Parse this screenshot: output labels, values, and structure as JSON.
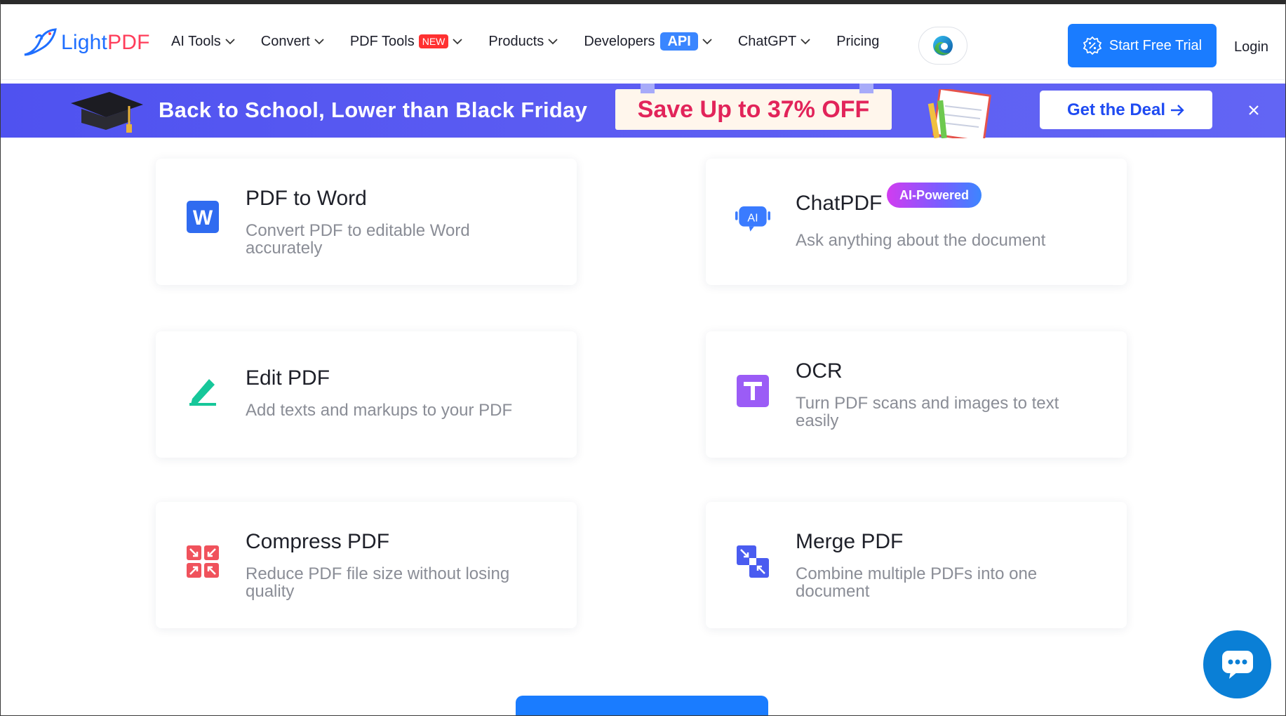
{
  "header": {
    "logo": {
      "light": "Light",
      "pdf": "PDF"
    },
    "nav": [
      {
        "label": "AI Tools",
        "has_chevron": true
      },
      {
        "label": "Convert",
        "has_chevron": true
      },
      {
        "label": "PDF Tools",
        "badge": "NEW",
        "has_chevron": true
      },
      {
        "label": "Products",
        "has_chevron": true
      },
      {
        "label": "Developers",
        "badge": "API",
        "has_chevron": true
      },
      {
        "label": "ChatGPT",
        "has_chevron": true
      },
      {
        "label": "Pricing",
        "has_chevron": false
      }
    ],
    "edge_icon": "edge-browser-icon",
    "trial_label": "Start Free Trial",
    "login_label": "Login"
  },
  "promo": {
    "headline": "Back to School, Lower than Black Friday",
    "save_text": "Save Up to 37% OFF",
    "deal_label": "Get the Deal",
    "colors": {
      "banner": "#5b5cf2",
      "save": "#e2245a",
      "deal_text": "#1f4bf2"
    }
  },
  "cards": [
    {
      "title": "PDF to Word",
      "desc": "Convert PDF to editable Word accurately",
      "icon": "word-icon",
      "color": "#2f6bf0"
    },
    {
      "title": "ChatPDF",
      "desc": "Ask anything about the document",
      "icon": "ai-chat-icon",
      "badge": "AI-Powered",
      "color": "#3a7bff"
    },
    {
      "title": "Edit PDF",
      "desc": "Add texts and markups to your PDF",
      "icon": "edit-pen-icon",
      "color": "#16c79a"
    },
    {
      "title": "OCR",
      "desc": "Turn PDF scans and images to text easily",
      "icon": "ocr-text-icon",
      "color": "#9b5cf6"
    },
    {
      "title": "Compress PDF",
      "desc": "Reduce PDF file size without losing quality",
      "icon": "compress-icon",
      "color": "#f0525c"
    },
    {
      "title": "Merge PDF",
      "desc": "Combine multiple PDFs into one document",
      "icon": "merge-icon",
      "color": "#4a5cf0"
    }
  ],
  "chat_widget": {
    "icon": "chat-bubble-icon"
  },
  "accent": "#1a7cff"
}
